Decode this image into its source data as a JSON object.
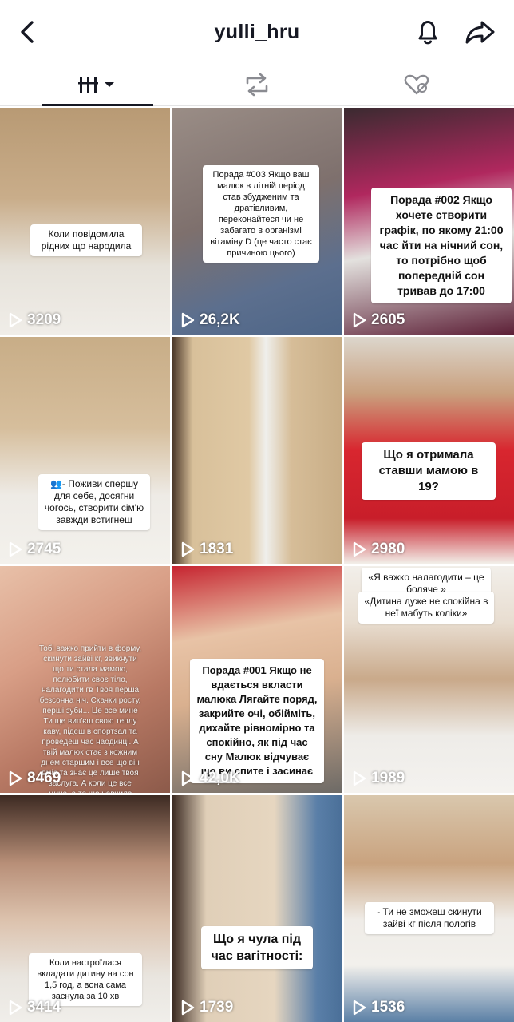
{
  "header": {
    "username": "yulli_hru"
  },
  "tabs": [
    {
      "name": "videos"
    },
    {
      "name": "reposts"
    },
    {
      "name": "liked"
    }
  ],
  "videos": [
    {
      "views": "3209",
      "caption": "Коли повідомила рідних що народила"
    },
    {
      "views": "26,2K",
      "caption": "Порада #003 Якщо ваш малюк в літній період став збудженим та дратівливим, переконайтеся чи не забагато в організмі вітаміну D (це часто стає причиною цього)"
    },
    {
      "views": "2605",
      "caption": "Порада #002 Якщо хочете створити графік, по якому 21:00 час йти на нічний сон, то потрібно щоб попередній сон тривав до 17:00"
    },
    {
      "views": "2745",
      "caption": "👥- Поживи спершу для себе, досягни чогось, створити сім'ю завжди встигнеш"
    },
    {
      "views": "1831",
      "caption": ""
    },
    {
      "views": "2980",
      "caption": "Що я отримала ставши мамою в 19?"
    },
    {
      "views": "8469",
      "caption": "Тобі важко прийти в форму, скинути зайві кг, звикнути що ти стала мамою, полюбити своє тіло, налагодити гв Твоя перша безсонна ніч. Скачки росту, перші зуби... Це все мине Ти ще вип'єш свою теплу каву, підеш в спортзал та проведеш час наодинці. А твій малюк стає з кожним днем старшим і все що він вміє та знає це лише твоя заслуга. А коли це все мине, а те що навчила мама назавжди"
    },
    {
      "views": "42,0K",
      "caption": "Порада #001 Якщо не вдається вкласти малюка Лягайте поряд, закрийте очі, обійміть, дихайте рівномірно та спокійно, як під час сну Малюк відчуває що ви спите і засинає"
    },
    {
      "views": "1989",
      "caption_top": "«Я важко налагодити – це боляче »",
      "caption": "«Дитина дуже не спокійна в неї мабуть коліки»"
    },
    {
      "views": "3414",
      "caption": "Коли настроїлася вкладати дитину на сон 1,5 год, а вона сама заснула за 10 хв"
    },
    {
      "views": "1739",
      "caption": "Що я чула під час вагітності:"
    },
    {
      "views": "1536",
      "caption": "- Ти не зможеш скинути зайві кг після пологів"
    }
  ]
}
